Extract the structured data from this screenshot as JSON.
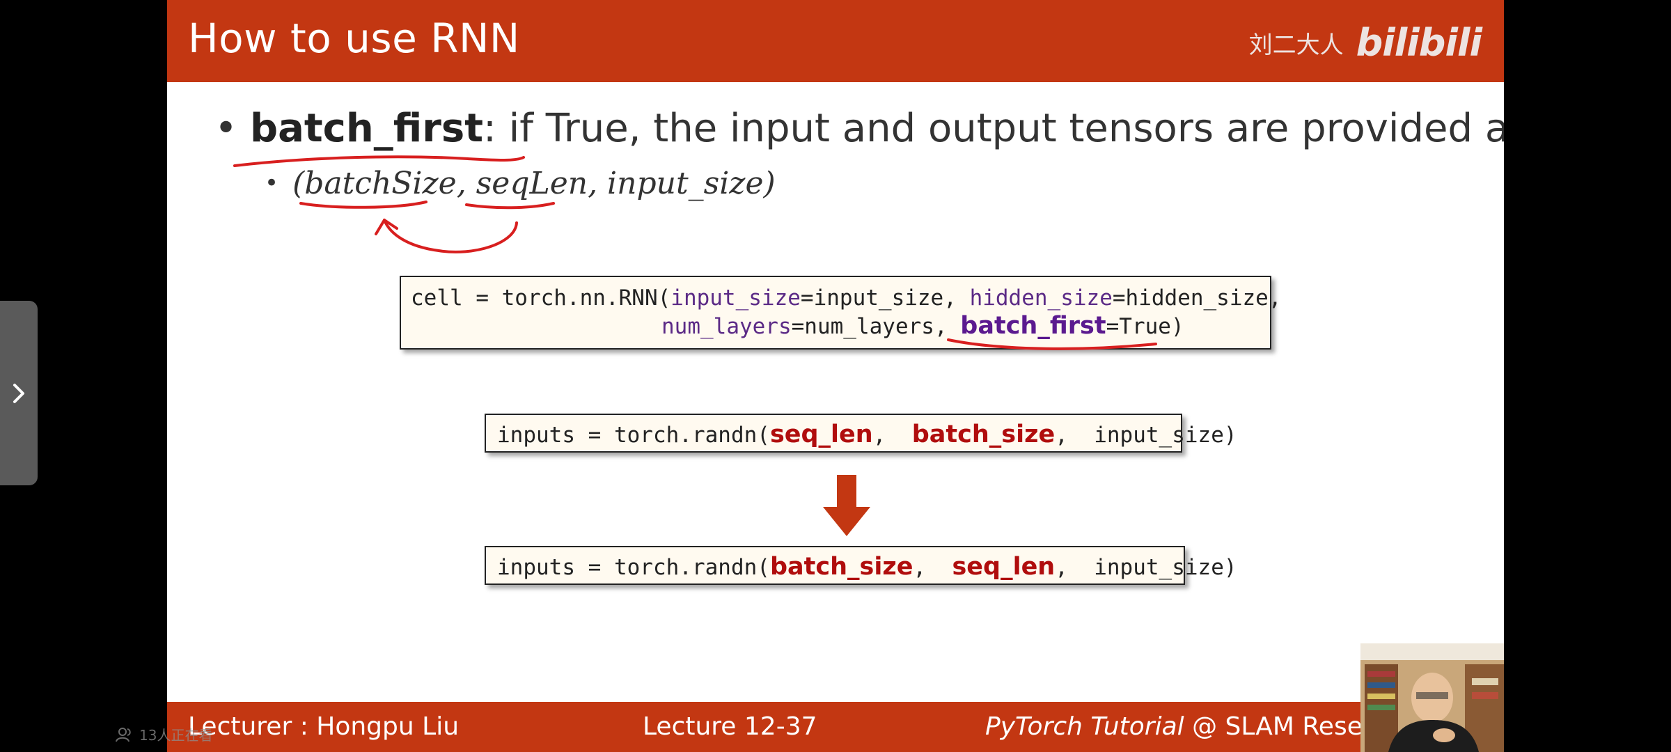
{
  "slide": {
    "title": "How to use RNN",
    "watermark": {
      "author": "刘二大人",
      "logo_text": "bilibili"
    },
    "bullet_main": {
      "term": "batch_first",
      "text": ": if True, the input and output tensors are provided as:"
    },
    "bullet_sub": {
      "text": "(batchSize, seqLen, input_size)"
    },
    "code_rnn": {
      "line1_prefix": "cell = torch.nn.RNN(",
      "arg1_name": "input_size",
      "arg1_eq": "=input_size, ",
      "arg2_name": "hidden_size",
      "arg2_eq": "=hidden_size,",
      "arg3_name": "num_layers",
      "arg3_eq": "=num_layers, ",
      "arg4_name": "batch_first",
      "arg4_eq": "=True)"
    },
    "code_before": {
      "prefix": "inputs = torch.randn(",
      "a": "seq_len",
      "sep1": ",  ",
      "b": "batch_size",
      "sep2": ",  ",
      "suffix": "input_size)"
    },
    "code_after": {
      "prefix": "inputs = torch.randn(",
      "a": "batch_size",
      "sep1": ",  ",
      "b": "seq_len",
      "sep2": ",  ",
      "suffix": "input_size)"
    },
    "footer": {
      "lecturer": "Lecturer : Hongpu Liu",
      "lecture": "Lecture 12-37",
      "course_italic": "PyTorch Tutorial",
      "course_rest": " @ SLAM Resea"
    }
  },
  "player": {
    "viewers_text": "13人正在看"
  },
  "colors": {
    "header_bg": "#c33712",
    "code_bg": "#fffaf0",
    "highlight_red": "#b00d0d",
    "highlight_purple": "#5b1a8f",
    "annotation_red": "#d81f1f"
  }
}
